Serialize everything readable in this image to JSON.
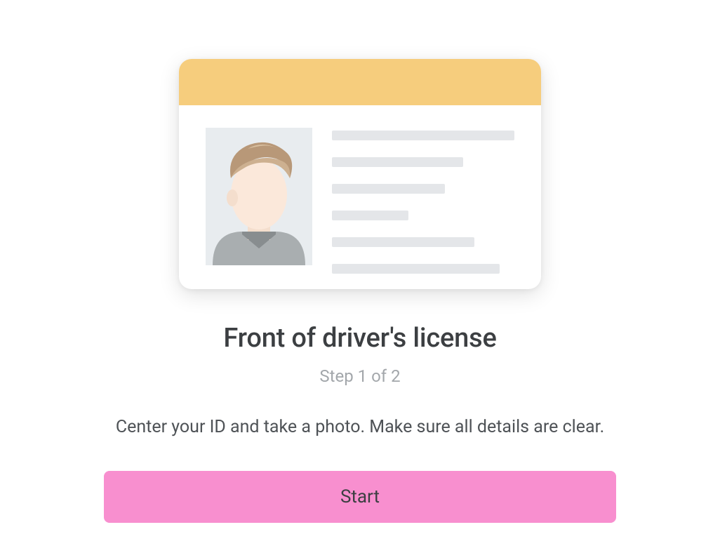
{
  "card": {
    "header_color": "#f6cd7d",
    "photo_bg": "#e8ecef",
    "line_widths": [
      100,
      72,
      62,
      42,
      78,
      92
    ]
  },
  "title": "Front of driver's license",
  "step_label": "Step 1 of 2",
  "instructions": "Center your ID and take a photo. Make sure all details are clear.",
  "button_label": "Start"
}
